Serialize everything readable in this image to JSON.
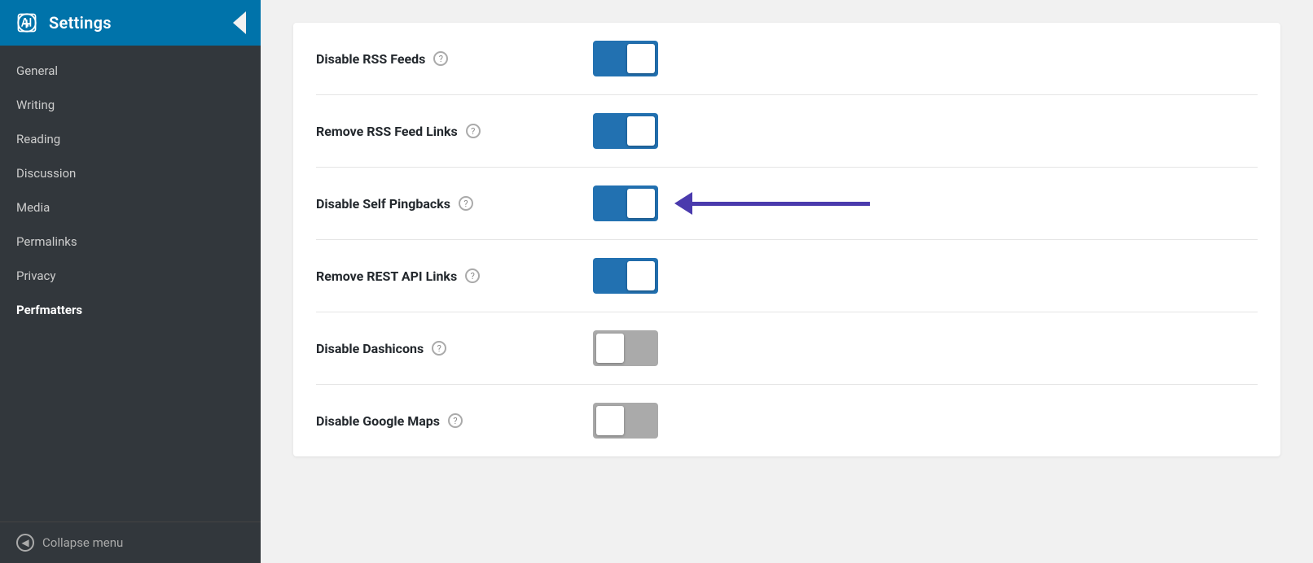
{
  "sidebar": {
    "header": {
      "title": "Settings",
      "icon": "wp-logo"
    },
    "items": [
      {
        "label": "General",
        "active": false
      },
      {
        "label": "Writing",
        "active": false
      },
      {
        "label": "Reading",
        "active": false
      },
      {
        "label": "Discussion",
        "active": false
      },
      {
        "label": "Media",
        "active": false
      },
      {
        "label": "Permalinks",
        "active": false
      },
      {
        "label": "Privacy",
        "active": false
      },
      {
        "label": "Perfmatters",
        "active": true
      }
    ],
    "collapse_label": "Collapse menu"
  },
  "main": {
    "settings": [
      {
        "id": "disable-rss-feeds",
        "label": "Disable RSS Feeds",
        "state": "on"
      },
      {
        "id": "remove-rss-feed-links",
        "label": "Remove RSS Feed Links",
        "state": "on"
      },
      {
        "id": "disable-self-pingbacks",
        "label": "Disable Self Pingbacks",
        "state": "on",
        "has_arrow": true
      },
      {
        "id": "remove-rest-api-links",
        "label": "Remove REST API Links",
        "state": "on"
      },
      {
        "id": "disable-dashicons",
        "label": "Disable Dashicons",
        "state": "off"
      },
      {
        "id": "disable-google-maps",
        "label": "Disable Google Maps",
        "state": "off"
      }
    ]
  },
  "colors": {
    "toggle_on": "#2271b1",
    "toggle_off": "#aaaaaa",
    "arrow": "#4a3aad",
    "sidebar_bg": "#32373c",
    "header_bg": "#0073aa"
  }
}
